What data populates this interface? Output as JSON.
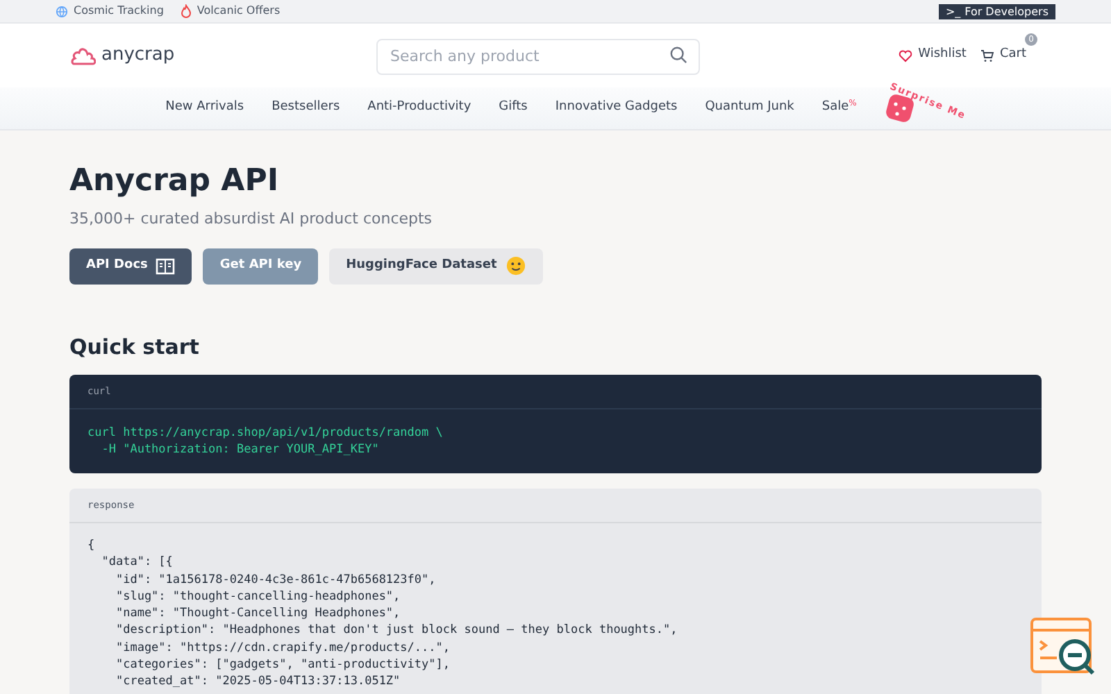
{
  "top_bar": {
    "links": [
      {
        "label": "Cosmic Tracking",
        "kind": "globe"
      },
      {
        "label": "Volcanic Offers",
        "kind": "flame"
      }
    ],
    "developer_button": {
      "icon": ">_",
      "label": "For Developers"
    }
  },
  "header": {
    "logo": "anycrap",
    "search": {
      "placeholder": "Search any product"
    },
    "wishlist": "Wishlist",
    "cart": {
      "label": "Cart",
      "count": "0"
    }
  },
  "nav": {
    "items": [
      {
        "label": "New Arrivals"
      },
      {
        "label": "Bestsellers"
      },
      {
        "label": "Anti-Productivity"
      },
      {
        "label": "Gifts"
      },
      {
        "label": "Innovative Gadgets"
      },
      {
        "label": "Quantum Junk"
      },
      {
        "label": "Sale",
        "badge": "%"
      }
    ],
    "surprise": "Surprise Me"
  },
  "hero": {
    "title": "Anycrap API",
    "subtitle": "35,000+ curated absurdist AI product concepts",
    "buttons": [
      {
        "label": "API Docs",
        "kind": "dark"
      },
      {
        "label": "Get API key",
        "kind": "muted"
      },
      {
        "label": "HuggingFace Dataset",
        "kind": "light"
      }
    ]
  },
  "quick_start": {
    "title": "Quick start",
    "request": {
      "label": "curl",
      "lines": [
        "curl https://anycrap.shop/api/v1/products/random \\",
        "  -H \"Authorization: Bearer YOUR_API_KEY\""
      ]
    },
    "response": {
      "label": "response",
      "lines": [
        "{",
        "  \"data\": [{",
        "    \"id\": \"1a156178-0240-4c3e-861c-47b6568123f0\",",
        "    \"slug\": \"thought-cancelling-headphones\",",
        "    \"name\": \"Thought-Cancelling Headphones\",",
        "    \"description\": \"Headphones that don't just block sound — they block thoughts.\",",
        "    \"image\": \"https://cdn.crapify.me/products/...\",",
        "    \"categories\": [\"gadgets\", \"anti-productivity\"],",
        "    \"created_at\": \"2025-05-04T13:37:13.051Z\""
      ]
    }
  }
}
